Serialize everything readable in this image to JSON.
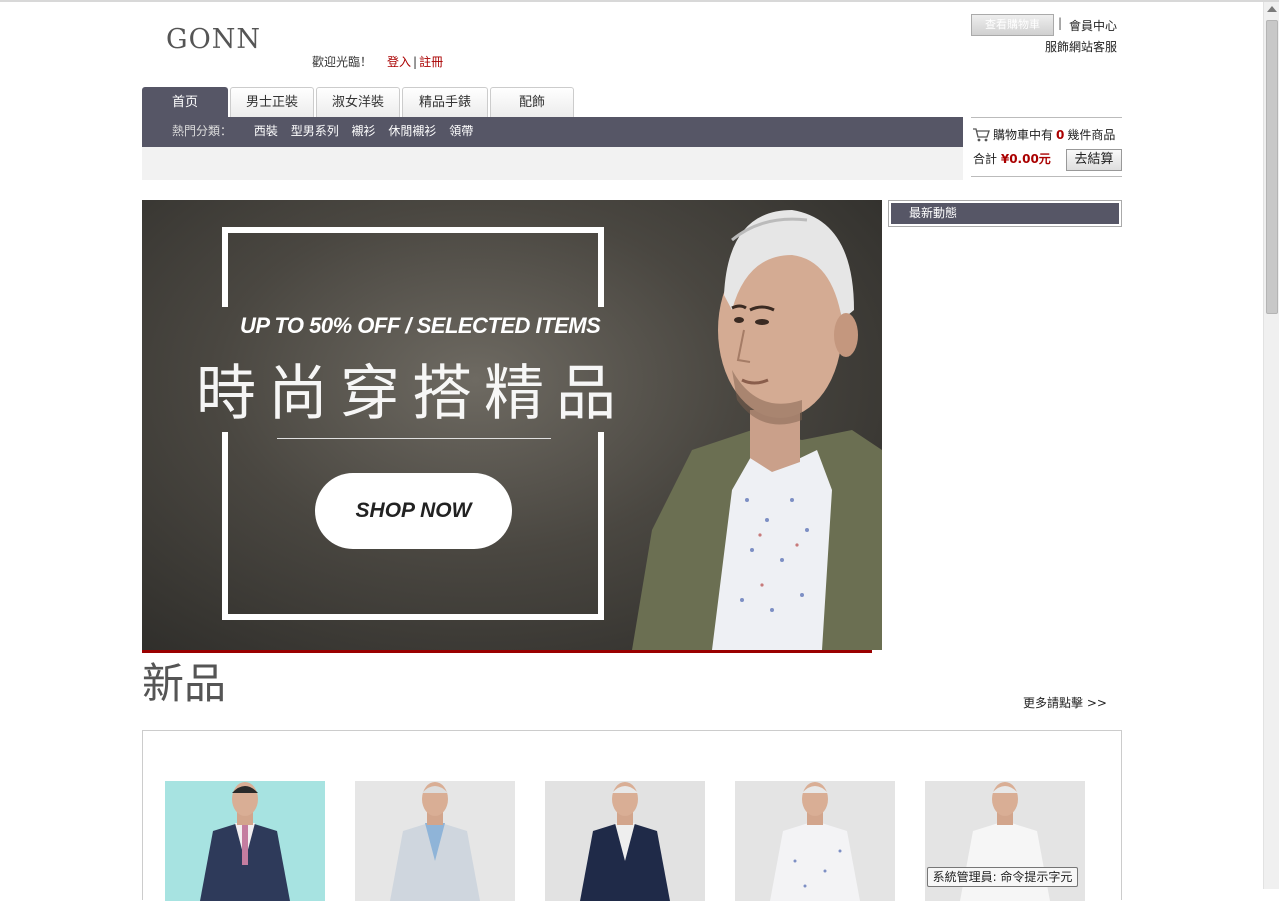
{
  "header": {
    "logo_text": "GONN",
    "welcome": "歡迎光臨！",
    "login_label": "登入",
    "register_label": "註冊",
    "grey_button_label": "查看購物車",
    "separator": "|",
    "member_center": "會員中心",
    "customer_service": "服飾網站客服"
  },
  "tabs": [
    {
      "label": "首页",
      "active": true
    },
    {
      "label": "男士正裝",
      "active": false
    },
    {
      "label": "淑女洋裝",
      "active": false
    },
    {
      "label": "精品手錶",
      "active": false
    },
    {
      "label": "配飾",
      "active": false
    }
  ],
  "nav": {
    "hot_label": "熱門分類：",
    "categories": [
      "西裝",
      "型男系列",
      "襯衫",
      "休閒襯衫",
      "領帶"
    ]
  },
  "cart": {
    "prefix": "購物車中有",
    "count": "0",
    "suffix": "幾件商品",
    "total_label": "合計",
    "total_value": "¥0.00元",
    "checkout_label": "去結算"
  },
  "banner": {
    "promo_text": "UP TO 50% OFF / SELECTED ITEMS",
    "title_cn": "時尚穿搭精品",
    "button_label": "SHOP NOW"
  },
  "news": {
    "title": "最新動態"
  },
  "new_products": {
    "title": "新品",
    "more_link": "更多請點擊 >>",
    "items": [
      {
        "name": "product-1",
        "bg": "#a7e3e1",
        "jacket": "#2e3a5a"
      },
      {
        "name": "product-2",
        "bg": "#e6e6e6",
        "jacket": "#cfd6de"
      },
      {
        "name": "product-3",
        "bg": "#e2e2e2",
        "jacket": "#1f2a48"
      },
      {
        "name": "product-4",
        "bg": "#e4e4e4",
        "jacket": "#f3f3f5"
      },
      {
        "name": "product-5",
        "bg": "#e4e4e4",
        "jacket": "#f6f6f6"
      }
    ]
  },
  "tooltip": {
    "text": "系統管理員: 命令提示字元"
  },
  "colors": {
    "nav_bg": "#565666",
    "accent_red": "#9a0000",
    "link_red": "#aa0000"
  }
}
